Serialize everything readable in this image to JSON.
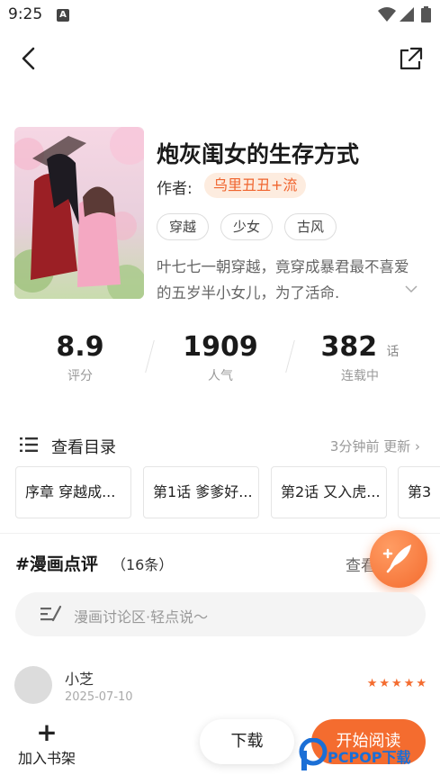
{
  "status_bar": {
    "time": "9:25",
    "notification_icon": "A"
  },
  "header": {
    "back_icon": "chevron-left-icon",
    "share_icon": "share-icon"
  },
  "book": {
    "title": "炮灰闺女的生存方式",
    "author_label": "作者:",
    "author": "乌里丑丑+流",
    "tags": [
      "穿越",
      "少女",
      "古风"
    ],
    "synopsis": "叶七七一朝穿越，竟穿成暴君最不喜爱的五岁半小女儿，为了活命."
  },
  "stats": [
    {
      "value": "8.9",
      "unit": "",
      "label": "评分"
    },
    {
      "value": "1909",
      "unit": "",
      "label": "人气"
    },
    {
      "value": "382",
      "unit": "话",
      "label": "连载中"
    }
  ],
  "toc": {
    "label": "查看目录",
    "update": "3分钟前 更新 ›"
  },
  "chapters": [
    "序章 穿越成...",
    "第1话 爹爹好...",
    "第2话 又入虎...",
    "第3"
  ],
  "comments": {
    "title": "#漫画点评",
    "count": "（16条）",
    "view_all": "查看",
    "input_placeholder": "漫画讨论区·轻点说～",
    "items": [
      {
        "name": "小芝",
        "date": "2025-07-10",
        "rating": 5
      }
    ]
  },
  "bottom": {
    "add_shelf": "加入书架",
    "download": "下载",
    "read": "开始阅读"
  },
  "watermark": "PCPOP下载",
  "colors": {
    "accent": "#f46c2f",
    "author_bg": "#fdecdf"
  }
}
